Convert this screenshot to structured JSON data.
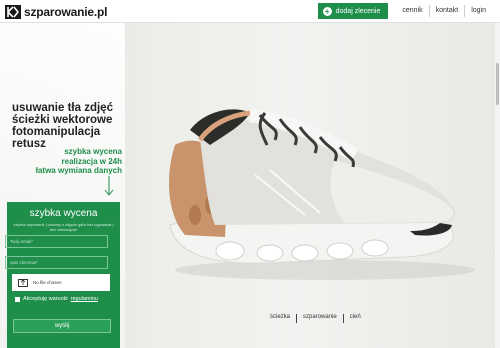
{
  "header": {
    "logo_text": "szparowanie.pl",
    "nav": {
      "add_order": "dodaj zlecenie",
      "pricing": "cennik",
      "contact": "kontakt",
      "login": "login"
    }
  },
  "hero": {
    "headline_lines": [
      "usuwanie tła zdjęć",
      "ścieżki wektorowe",
      "fotomanipulacja",
      "retusz"
    ],
    "sub_lines": [
      "szybka wycena",
      "realizacja w 24h",
      "łatwa wymiana danych"
    ]
  },
  "quote_form": {
    "title": "szybka wycena",
    "description": "szybka odpowiedź | prosimy o zdjęcie galio bez logowania | bez zobowiązań",
    "email_placeholder": "Twój email*",
    "details_placeholder": "opis zlecenia*",
    "file_label": "No file chosen",
    "accept_text": "Akceptuję warunki",
    "accept_link": "regulaminu",
    "submit_label": "wyślij"
  },
  "bottom_links": [
    "ścieżka",
    "szparowanie",
    "cień"
  ],
  "colors": {
    "accent": "#1e8e4a",
    "text": "#222222"
  },
  "icons": {
    "logo": "logo-mark-icon",
    "add": "plus-circle-icon",
    "arrow": "arrow-down-icon",
    "file": "file-upload-icon"
  }
}
